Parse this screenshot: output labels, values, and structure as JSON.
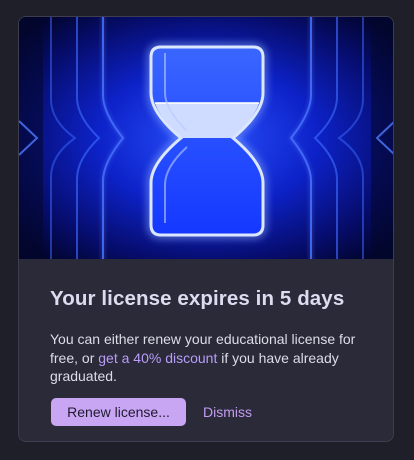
{
  "license_notice": {
    "hero_icon": "hourglass-icon",
    "title": "Your license expires in 5 days",
    "body_before_link": "You can either renew your educational license for free, or ",
    "discount_link": "get a 40% discount",
    "body_after_link": " if you have already graduated.",
    "renew_button": "Renew license...",
    "dismiss_button": "Dismiss"
  },
  "colors": {
    "background": "#1f1f2a",
    "card": "#2a2a39",
    "accent": "#c9a6f4",
    "link": "#b99cf8",
    "hero_blue": "#1d3cff"
  }
}
